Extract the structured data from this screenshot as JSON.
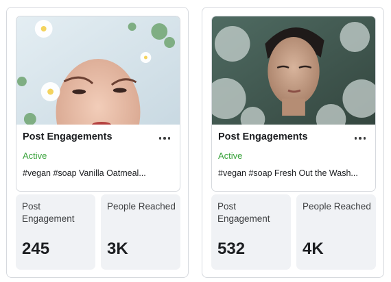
{
  "cards": [
    {
      "thumbnail_icon": "photo-woman-in-milk-bath-icon",
      "title": "Post Engagements",
      "status": "Active",
      "caption": "#vegan #soap Vanilla Oatmeal...",
      "metrics": [
        {
          "label": "Post Engagement",
          "value": "245"
        },
        {
          "label": "People Reached",
          "value": "3K"
        }
      ]
    },
    {
      "thumbnail_icon": "photo-man-in-bath-icon",
      "title": "Post Engagements",
      "status": "Active",
      "caption": "#vegan #soap Fresh Out the Wash...",
      "metrics": [
        {
          "label": "Post Engagement",
          "value": "532"
        },
        {
          "label": "People Reached",
          "value": "4K"
        }
      ]
    }
  ],
  "colors": {
    "status_active": "#3aa33c",
    "metric_bg": "#f0f2f5",
    "border": "#d6d9de"
  }
}
